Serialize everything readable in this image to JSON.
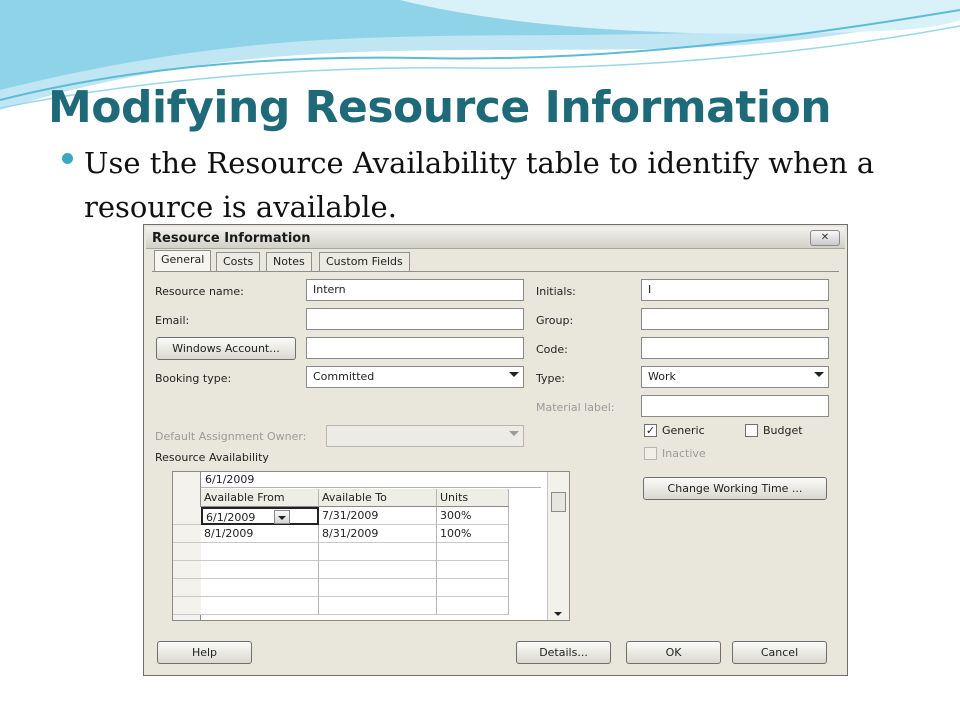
{
  "slide": {
    "title": "Modifying Resource Information",
    "bullet": "Use the Resource Availability table to identify when a resource is available."
  },
  "dialog": {
    "title": "Resource Information",
    "close_label": "✕",
    "tabs": [
      {
        "label": "General",
        "active": true
      },
      {
        "label": "Costs",
        "active": false
      },
      {
        "label": "Notes",
        "active": false
      },
      {
        "label": "Custom Fields",
        "active": false
      }
    ],
    "fields": {
      "resource_name_label": "Resource name:",
      "resource_name_value": "Intern",
      "email_label": "Email:",
      "email_value": "",
      "windows_account_button": "Windows Account...",
      "windows_account_value": "",
      "booking_type_label": "Booking type:",
      "booking_type_value": "Committed",
      "initials_label": "Initials:",
      "initials_value": "I",
      "group_label": "Group:",
      "group_value": "",
      "code_label": "Code:",
      "code_value": "",
      "type_label": "Type:",
      "type_value": "Work",
      "material_label_label": "Material label:",
      "material_label_value": "",
      "default_owner_label": "Default Assignment Owner:",
      "default_owner_value": ""
    },
    "checkboxes": {
      "generic_label": "Generic",
      "generic_checked": true,
      "budget_label": "Budget",
      "budget_checked": false,
      "inactive_label": "Inactive",
      "inactive_checked": false
    },
    "change_working_time_button": "Change Working Time ...",
    "availability": {
      "section_label": "Resource Availability",
      "entry_value": "6/1/2009",
      "columns": [
        "Available From",
        "Available To",
        "Units"
      ],
      "rows": [
        [
          "6/1/2009",
          "7/31/2009",
          "300%"
        ],
        [
          "8/1/2009",
          "8/31/2009",
          "100%"
        ]
      ]
    },
    "footer": {
      "help": "Help",
      "details": "Details...",
      "ok": "OK",
      "cancel": "Cancel"
    }
  }
}
